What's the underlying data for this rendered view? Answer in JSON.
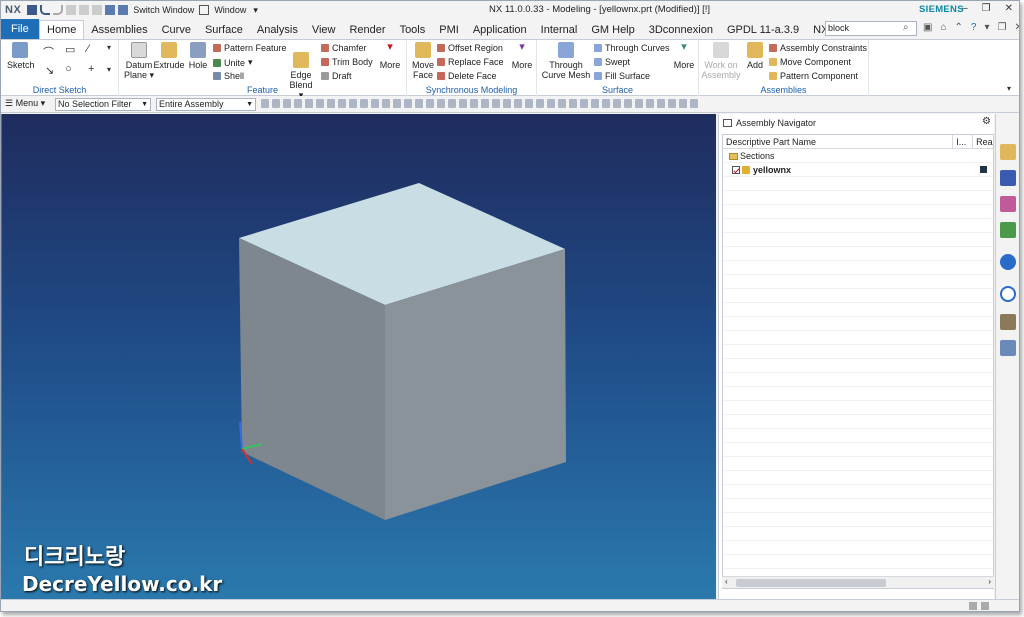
{
  "app": {
    "logo": "NX",
    "window_title": "NX 11.0.0.33 - Modeling - [yellownx.prt (Modified)]      [!]",
    "brand": "SIEMENS",
    "switch_window": "Switch Window",
    "window_menu": "Window"
  },
  "menu": {
    "file": "File",
    "tabs": [
      "Home",
      "Assemblies",
      "Curve",
      "Surface",
      "Analysis",
      "View",
      "Render",
      "Tools",
      "PMI",
      "Application",
      "Internal",
      "GM Help",
      "3Dconnexion",
      "GPDL 11-a.3.9",
      "NX-VPS"
    ],
    "search_value": "block"
  },
  "ribbon": {
    "direct_sketch": {
      "label": "Direct Sketch",
      "sketch": "Sketch"
    },
    "feature": {
      "label": "Feature",
      "datum_plane": "Datum Plane",
      "extrude": "Extrude",
      "hole": "Hole",
      "pattern_feature": "Pattern Feature",
      "unite": "Unite",
      "shell": "Shell",
      "edge_blend": "Edge Blend",
      "chamfer": "Chamfer",
      "trim_body": "Trim Body",
      "draft": "Draft",
      "more": "More"
    },
    "sync": {
      "label": "Synchronous Modeling",
      "move_face": "Move Face",
      "offset_region": "Offset Region",
      "replace_face": "Replace Face",
      "delete_face": "Delete Face",
      "more": "More"
    },
    "surface": {
      "label": "Surface",
      "through_curve_mesh": "Through Curve Mesh",
      "through_curves": "Through Curves",
      "swept": "Swept",
      "fill_surface": "Fill Surface",
      "more": "More"
    },
    "assemblies": {
      "label": "Assemblies",
      "work_on_assembly": "Work on Assembly",
      "add": "Add",
      "assembly_constraints": "Assembly Constraints",
      "move_component": "Move Component",
      "pattern_component": "Pattern Component"
    }
  },
  "selection_bar": {
    "menu": "Menu",
    "filter": "No Selection Filter",
    "scope": "Entire Assembly"
  },
  "navigator": {
    "title": "Assembly Navigator",
    "columns": [
      "Descriptive Part Name",
      "I...",
      "Rea"
    ],
    "rows": [
      {
        "name": "Sections",
        "type": "folder"
      },
      {
        "name": "yellownx",
        "type": "part"
      }
    ]
  },
  "watermark": {
    "korean": "디크리노랑",
    "url": "DecreYellow.co.kr"
  },
  "colors": {
    "file_tab": "#1f6fb8",
    "group_label": "#1f5ea8",
    "brand": "#0a8aa6",
    "cube_top": "#c8dde4",
    "cube_left": "#7d878d",
    "cube_right": "#8a9399"
  }
}
